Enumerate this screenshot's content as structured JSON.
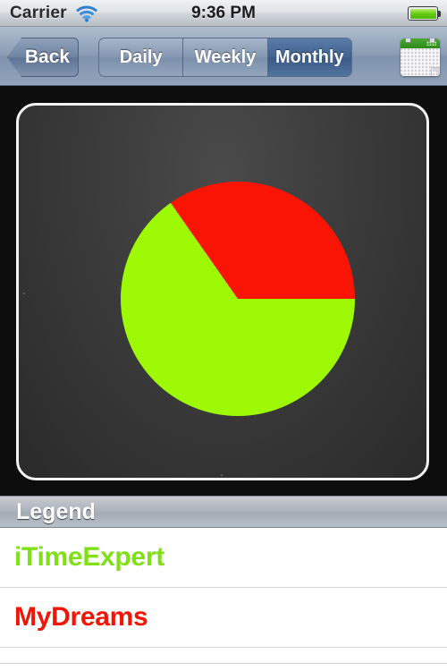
{
  "status_bar": {
    "carrier": "Carrier",
    "wifi_icon": "wifi-icon",
    "time": "9:36 PM",
    "battery_icon": "battery-full-icon"
  },
  "nav_bar": {
    "back_label": "Back",
    "segments": [
      {
        "label": "Daily",
        "selected": false
      },
      {
        "label": "Weekly",
        "selected": false
      },
      {
        "label": "Monthly",
        "selected": true
      }
    ],
    "calendar_icon": "calendar-icon"
  },
  "legend": {
    "header": "Legend",
    "items": [
      {
        "label": "iTimeExpert",
        "color": "#7FE015"
      },
      {
        "label": "MyDreams",
        "color": "#F21405"
      }
    ]
  },
  "chart_data": {
    "type": "pie",
    "title": "",
    "categories": [
      "iTimeExpert",
      "MyDreams"
    ],
    "values": [
      75,
      25
    ],
    "colors": [
      "#9DFA04",
      "#FA1404"
    ],
    "start_angle_deg": -35,
    "legend_position": "below",
    "background": "#3b3b3b"
  }
}
